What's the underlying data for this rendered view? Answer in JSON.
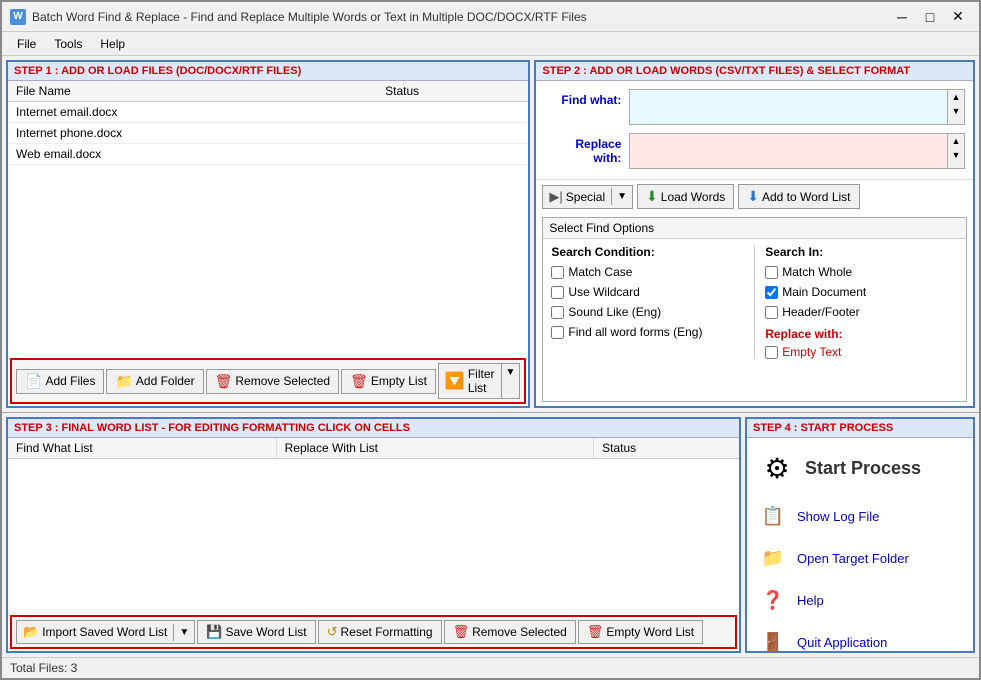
{
  "titleBar": {
    "icon": "W",
    "title": "Batch Word Find & Replace - Find and Replace Multiple Words or Text  in Multiple DOC/DOCX/RTF Files",
    "minimize": "─",
    "maximize": "□",
    "close": "✕"
  },
  "menuBar": {
    "items": [
      "File",
      "Tools",
      "Help"
    ]
  },
  "step1": {
    "header": "STEP 1 : ADD OR LOAD FILES (DOC/DOCX/RTF FILES)",
    "columns": [
      "File Name",
      "Status"
    ],
    "files": [
      {
        "name": "Internet email.docx",
        "status": ""
      },
      {
        "name": "Internet phone.docx",
        "status": ""
      },
      {
        "name": "Web email.docx",
        "status": ""
      }
    ],
    "toolbar": {
      "addFiles": "Add Files",
      "addFolder": "Add Folder",
      "removeSelected": "Remove Selected",
      "emptyList": "Empty List",
      "filterList": "Filter List"
    }
  },
  "step2": {
    "header": "STEP 2 : ADD OR LOAD WORDS (CSV/TXT FILES) & SELECT FORMAT",
    "findLabel": "Find what:",
    "replaceLabel": "Replace with:",
    "toolbar": {
      "special": "Special",
      "loadWords": "Load Words",
      "addToWordList": "Add to Word List"
    },
    "findOptions": {
      "header": "Select Find Options",
      "searchConditionLabel": "Search Condition:",
      "searchInLabel": "Search In:",
      "options": [
        {
          "label": "Match Case",
          "checked": false
        },
        {
          "label": "Match Whole",
          "checked": false
        },
        {
          "label": "Use Wildcard",
          "checked": false
        },
        {
          "label": "Main Document",
          "checked": true
        },
        {
          "label": "Sound Like (Eng)",
          "checked": false
        },
        {
          "label": "Header/Footer",
          "checked": false
        },
        {
          "label": "Find all word forms (Eng)",
          "checked": false
        }
      ],
      "replaceWithLabel": "Replace with:",
      "emptyTextLabel": "Empty Text"
    }
  },
  "step3": {
    "header": "STEP 3 : FINAL WORD LIST - FOR EDITING FORMATTING CLICK ON CELLS",
    "columns": [
      "Find What List",
      "Replace With List",
      "Status"
    ],
    "toolbar": {
      "importSavedWordList": "Import Saved Word List",
      "saveWordList": "Save Word List",
      "resetFormatting": "Reset Formatting",
      "removeSelected": "Remove Selected",
      "emptyWordList": "Empty Word List"
    }
  },
  "step4": {
    "header": "STEP 4 : START PROCESS",
    "startProcess": "Start Process",
    "showLogFile": "Show Log File",
    "openTargetFolder": "Open Target Folder",
    "help": "Help",
    "quitApplication": "Quit Application"
  },
  "statusBar": {
    "text": "Total Files: 3"
  }
}
